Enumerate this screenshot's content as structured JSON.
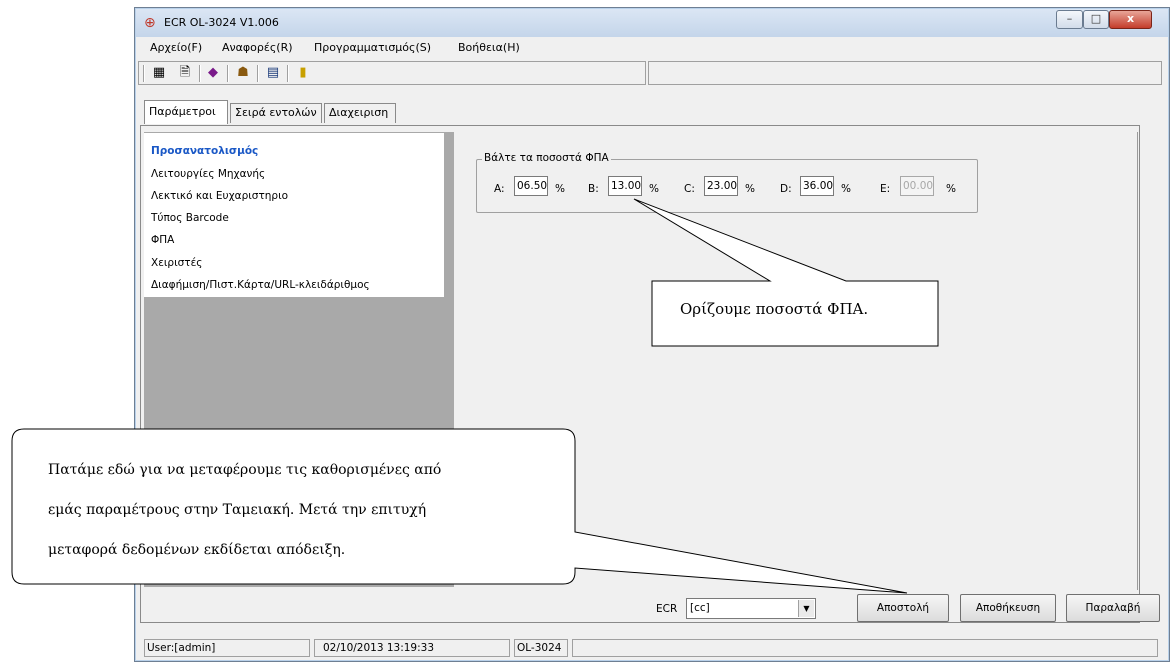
{
  "window": {
    "title": "ECR OL-3024 V1.006",
    "controls": [
      "–",
      "□",
      "x"
    ]
  },
  "menu": [
    "Αρχείο(F)",
    "Αναφορές(R)",
    "Προγραμματισμός(S)",
    "Βοήθεια(H)"
  ],
  "toolbar_icons": [
    "calculator-icon",
    "document-icon",
    "color-palette-icon",
    "users-icon",
    "export-icon",
    "door-exit-icon"
  ],
  "tabs": [
    "Παράμετροι",
    "Σειρά εντολών",
    "Διαχειριση"
  ],
  "nav": {
    "items": [
      "Προσανατολισμός",
      "Λειτουργίες Μηχανής",
      "Λεκτικό και Ευχαριστηριο",
      "Τύπος Barcode",
      "ΦΠΑ",
      "Χειριστές",
      "Διαφήμιση/Πιστ.Κάρτα/URL-κλειδάριθμος"
    ],
    "selected": "Προσανατολισμός"
  },
  "vat": {
    "legend": "Βάλτε τα ποσοστά ΦΠΑ",
    "fields": [
      {
        "label": "A:",
        "value": "06.50",
        "unit": "%"
      },
      {
        "label": "B:",
        "value": "13.00",
        "unit": "%"
      },
      {
        "label": "C:",
        "value": "23.00",
        "unit": "%"
      },
      {
        "label": "D:",
        "value": "36.00",
        "unit": "%"
      },
      {
        "label": "E:",
        "value": "00.00",
        "unit": "%"
      }
    ]
  },
  "bottom": {
    "ecr_label": "ECR",
    "ecr_value": "[cc]",
    "buttons": [
      "Αποστολή",
      "Αποθήκευση",
      "Παραλαβή"
    ]
  },
  "status": {
    "user": "User:[admin]",
    "datetime": "02/10/2013 13:19:33",
    "model": "OL-3024"
  },
  "callouts": {
    "vat_note": "Ορίζουμε ποσοστά ΦΠΑ.",
    "send_note_lines": [
      "Πατάμε εδώ για να μεταφέρουμε τις καθορισμένες από",
      "εμάς παραμέτρους στην Ταμειακή. Μετά την επιτυχή",
      "μεταφορά δεδομένων εκδίδεται απόδειξη."
    ]
  }
}
